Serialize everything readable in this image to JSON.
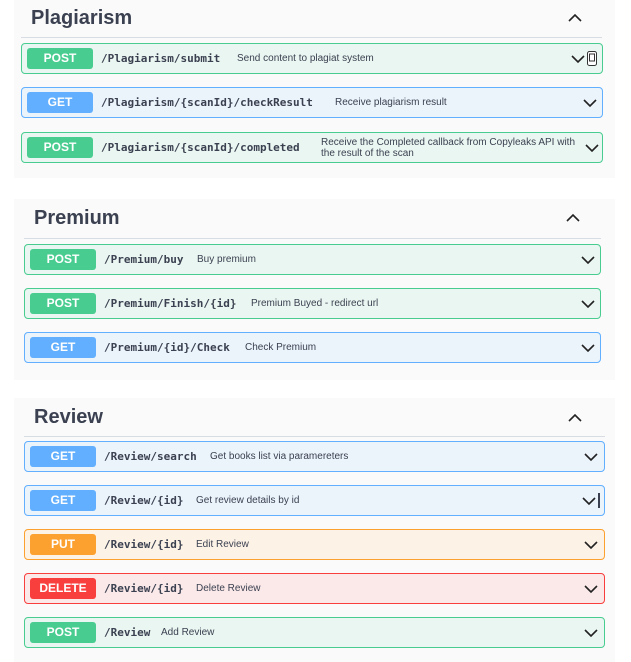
{
  "sections": [
    {
      "title": "Plagiarism",
      "ops": [
        {
          "method": "POST",
          "path": "/Plagiarism/submit",
          "summary": "Send content to plagiat system"
        },
        {
          "method": "GET",
          "path": "/Plagiarism/{scanId}/checkResult",
          "summary": "Receive plagiarism result"
        },
        {
          "method": "POST",
          "path": "/Plagiarism/{scanId}/completed",
          "summary": "Receive the Completed callback from Copyleaks API with the result of the scan"
        }
      ]
    },
    {
      "title": "Premium",
      "ops": [
        {
          "method": "POST",
          "path": "/Premium/buy",
          "summary": "Buy premium"
        },
        {
          "method": "POST",
          "path": "/Premium/Finish/{id}",
          "summary": "Premium Buyed - redirect url"
        },
        {
          "method": "GET",
          "path": "/Premium/{id}/Check",
          "summary": "Check Premium"
        }
      ]
    },
    {
      "title": "Review",
      "ops": [
        {
          "method": "GET",
          "path": "/Review/search",
          "summary": "Get books list via paramereters"
        },
        {
          "method": "GET",
          "path": "/Review/{id}",
          "summary": "Get review details by id"
        },
        {
          "method": "PUT",
          "path": "/Review/{id}",
          "summary": "Edit Review"
        },
        {
          "method": "DELETE",
          "path": "/Review/{id}",
          "summary": "Delete Review"
        },
        {
          "method": "POST",
          "path": "/Review",
          "summary": "Add Review"
        }
      ]
    }
  ],
  "colors": {
    "post": "#49cc90",
    "get": "#61affe",
    "put": "#fca130",
    "delete": "#f93e3e",
    "text": "#3b4151"
  },
  "icons": {
    "section_toggle": "chevron-up-icon",
    "op_toggle": "chevron-down-icon",
    "copy": "copy-icon"
  }
}
